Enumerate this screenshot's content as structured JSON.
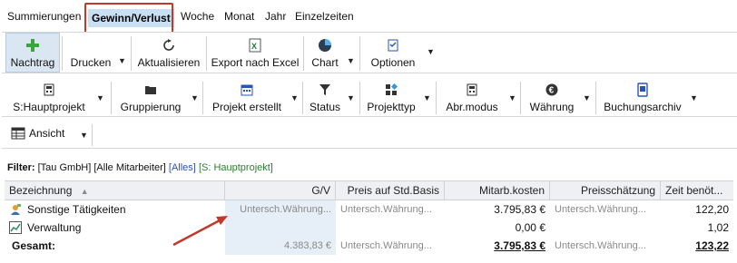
{
  "tabs": [
    "Summierungen",
    "Gewinn/Verlust",
    "Woche",
    "Monat",
    "Jahr",
    "Einzelzeiten"
  ],
  "toolbar1": {
    "nachtrag": "Nachtrag",
    "drucken": "Drucken",
    "aktualisieren": "Aktualisieren",
    "export": "Export nach Excel",
    "chart": "Chart",
    "optionen": "Optionen"
  },
  "toolbar2": {
    "hauptprojekt": "S:Hauptprojekt",
    "gruppierung": "Gruppierung",
    "projekt_erstellt": "Projekt erstellt",
    "status": "Status",
    "projekttyp": "Projekttyp",
    "abr_modus": "Abr.modus",
    "waehrung": "Währung",
    "buchungsarchiv": "Buchungsarchiv"
  },
  "toolbar3": {
    "ansicht": "Ansicht"
  },
  "filter": {
    "label": "Filter:",
    "text": "[Tau GmbH] [Alle Mitarbeiter]",
    "alles": "[Alles]",
    "project": "[S: Hauptprojekt]"
  },
  "table": {
    "columns": [
      "Bezeichnung",
      "G/V",
      "Preis auf Std.Basis",
      "Mitarb.kosten",
      "Preisschätzung",
      "Zeit benöt..."
    ],
    "rows": [
      {
        "name": "Sonstige Tätigkeiten",
        "gv": "Untersch.Währung...",
        "preis": "Untersch.Währung...",
        "kosten": "3.795,83 €",
        "schaetzung": "Untersch.Währung...",
        "zeit": "122,20"
      },
      {
        "name": "Verwaltung",
        "gv": "",
        "preis": "",
        "kosten": "0,00 €",
        "schaetzung": "",
        "zeit": "1,02"
      }
    ],
    "total": {
      "name": "Gesamt:",
      "gv": "4.383,83 €",
      "preis": "Untersch.Währung...",
      "kosten": "3.795,83 €",
      "schaetzung": "Untersch.Währung...",
      "zeit": "123,22"
    }
  }
}
